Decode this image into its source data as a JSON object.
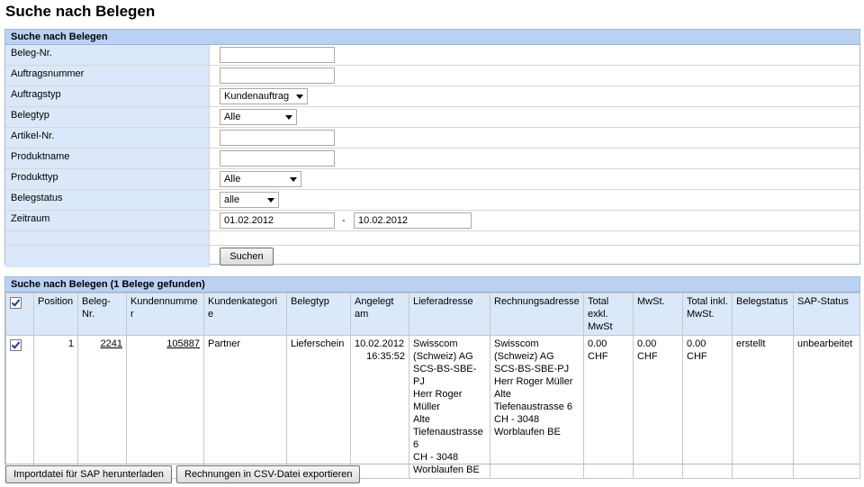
{
  "page": {
    "title": "Suche nach Belegen"
  },
  "search": {
    "header": "Suche nach Belegen",
    "fields": {
      "beleg_nr": {
        "label": "Beleg-Nr.",
        "value": ""
      },
      "auftragsnummer": {
        "label": "Auftragsnummer",
        "value": ""
      },
      "auftragstyp": {
        "label": "Auftragstyp",
        "selected": "Kundenauftrag"
      },
      "belegtyp": {
        "label": "Belegtyp",
        "selected": "Alle"
      },
      "artikel_nr": {
        "label": "Artikel-Nr.",
        "value": ""
      },
      "produktname": {
        "label": "Produktname",
        "value": ""
      },
      "produkttyp": {
        "label": "Produkttyp",
        "selected": "Alle"
      },
      "belegstatus": {
        "label": "Belegstatus",
        "selected": "alle"
      },
      "zeitraum": {
        "label": "Zeitraum",
        "from": "01.02.2012",
        "separator": "-",
        "to": "10.02.2012"
      }
    },
    "submit_label": "Suchen"
  },
  "results": {
    "header": "Suche nach Belegen (1 Belege gefunden)",
    "columns": [
      "Position",
      "Beleg-Nr.",
      "Kundennummer",
      "Kundenkategorie",
      "Belegtyp",
      "Angelegt am",
      "Lieferadresse",
      "Rechnungsadresse",
      "Total exkl. MwSt",
      "MwSt.",
      "Total inkl. MwSt.",
      "Belegstatus",
      "SAP-Status"
    ],
    "rows": [
      {
        "checked": true,
        "position": "1",
        "beleg_nr": "2241",
        "kundennummer": "105887",
        "kundenkategorie": "Partner",
        "belegtyp": "Lieferschein",
        "angelegt_date": "10.02.2012",
        "angelegt_time": "16:35:52",
        "lieferadresse": [
          "Swisscom",
          "(Schweiz) AG",
          "SCS-BS-SBE-PJ",
          "Herr Roger",
          "Müller",
          "Alte",
          "Tiefenaustrasse",
          "6",
          "CH - 3048",
          "Worblaufen BE"
        ],
        "rechnungsadresse": [
          "Swisscom",
          "(Schweiz) AG",
          "SCS-BS-SBE-PJ",
          "Herr Roger Müller",
          "Alte",
          "Tiefenaustrasse 6",
          "CH - 3048",
          "Worblaufen BE"
        ],
        "total_exkl": "0.00 CHF",
        "mwst": "0.00 CHF",
        "total_inkl": "0.00 CHF",
        "belegstatus": "erstellt",
        "sap_status": "unbearbeitet"
      }
    ]
  },
  "actions": {
    "export_sap_label": "Importdatei für SAP herunterladen",
    "export_csv_label": "Rechnungen in CSV-Datei exportieren"
  }
}
